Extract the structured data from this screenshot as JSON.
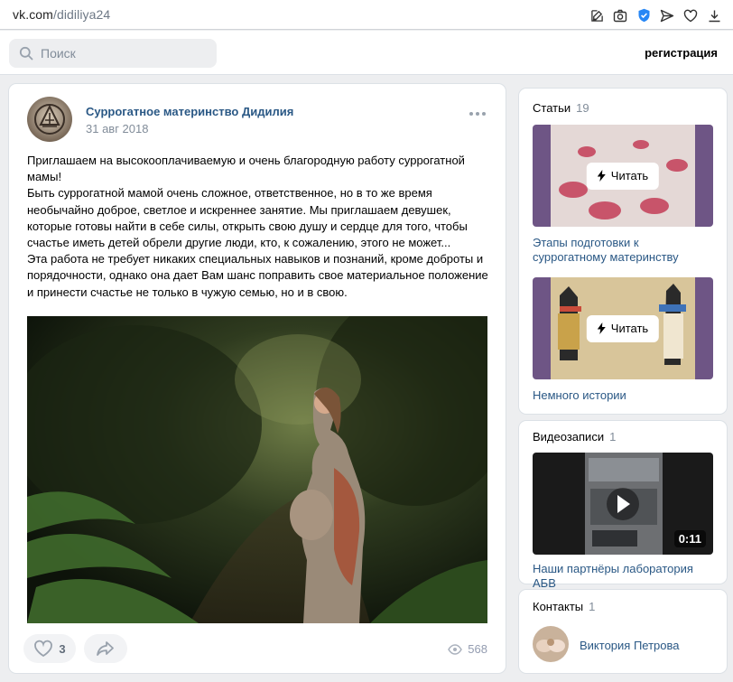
{
  "browser": {
    "url_domain": "vk.com",
    "url_path": "/didiliya24",
    "icons": [
      "edit-icon",
      "camera-icon",
      "shield-check-icon",
      "send-icon",
      "heart-icon",
      "download-icon"
    ]
  },
  "header": {
    "search_placeholder": "Поиск",
    "register_label": "регистрация"
  },
  "post": {
    "author": "Суррогатное материнство Дидилия",
    "date": "31 авг 2018",
    "paragraphs": [
      "Приглашаем на высокооплачиваемую и очень благородную работу суррогатной мамы!",
      "Быть суррогатной мамой очень сложное, ответственное, но в то же время необычайно доброе, светлое и искреннее занятие. Мы приглашаем девушек, которые готовы найти в себе силы, открыть свою душу и сердце для того, чтобы счастье иметь детей обрели другие люди, кто, к сожалению, этого не может...",
      "Эта работа не требует никаких специальных навыков и познаний, кроме доброты и порядочности, однако она дает Вам шанс поправить свое материальное положение и принести счастье не только в чужую семью, но и в свою."
    ],
    "likes": "3",
    "views": "568"
  },
  "articles": {
    "title": "Статьи",
    "count": "19",
    "read_label": "Читать",
    "items": [
      {
        "title": "Этапы подготовки к суррогатному материнству"
      },
      {
        "title": "Немного истории"
      }
    ]
  },
  "videos": {
    "title": "Видеозаписи",
    "count": "1",
    "items": [
      {
        "title": "Наши партнёры лаборатория АБВ",
        "duration": "0:11"
      }
    ]
  },
  "contacts": {
    "title": "Контакты",
    "count": "1",
    "items": [
      {
        "name": "Виктория Петрова"
      }
    ]
  },
  "colors": {
    "link": "#2a5885",
    "muted": "#818c99",
    "background": "#edeef0"
  }
}
